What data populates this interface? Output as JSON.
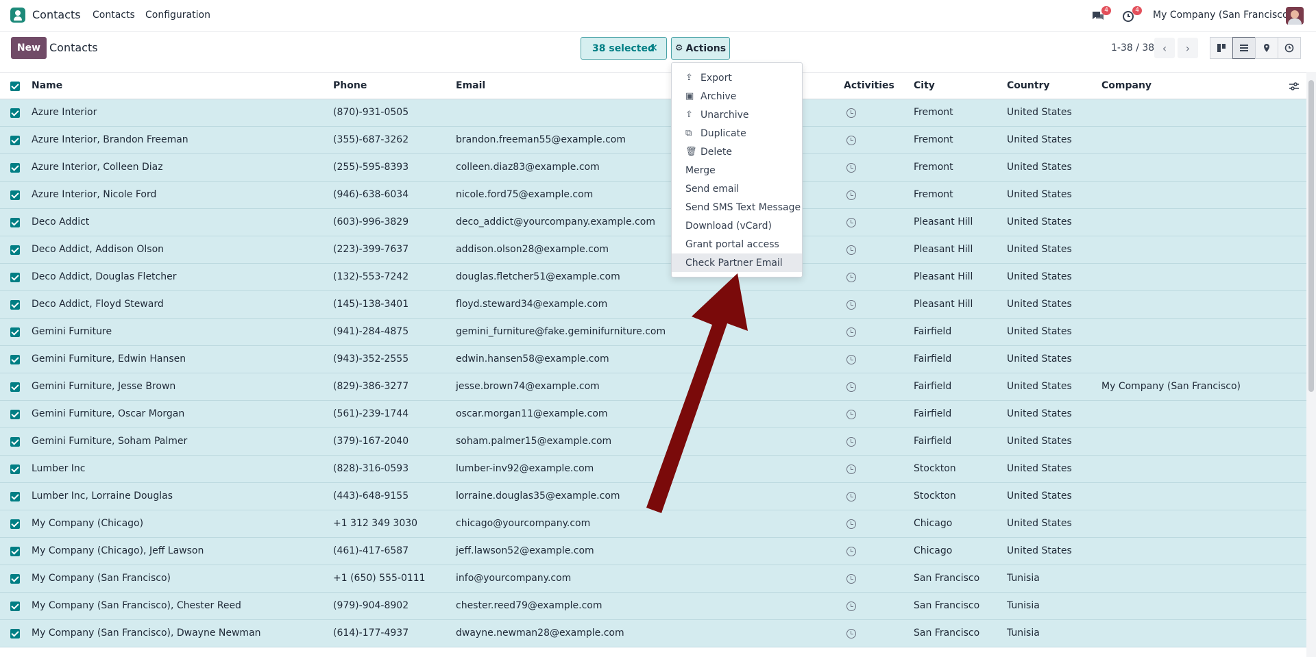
{
  "navbar": {
    "app_name": "Contacts",
    "menu": [
      "Contacts",
      "Configuration"
    ],
    "messages_badge": "4",
    "activities_badge": "4",
    "company": "My Company (San Francisco)"
  },
  "control": {
    "new_label": "New",
    "breadcrumb": "Contacts",
    "selected_label": "38 selected",
    "actions_label": "Actions",
    "pager": "1-38 / 38"
  },
  "columns": {
    "name": "Name",
    "phone": "Phone",
    "email": "Email",
    "activities": "Activities",
    "city": "City",
    "country": "Country",
    "company": "Company"
  },
  "rows": [
    {
      "name": "Azure Interior",
      "phone": "(870)-931-0505",
      "email": "",
      "city": "Fremont",
      "country": "United States",
      "company": ""
    },
    {
      "name": "Azure Interior, Brandon Freeman",
      "phone": "(355)-687-3262",
      "email": "brandon.freeman55@example.com",
      "city": "Fremont",
      "country": "United States",
      "company": ""
    },
    {
      "name": "Azure Interior, Colleen Diaz",
      "phone": "(255)-595-8393",
      "email": "colleen.diaz83@example.com",
      "city": "Fremont",
      "country": "United States",
      "company": ""
    },
    {
      "name": "Azure Interior, Nicole Ford",
      "phone": "(946)-638-6034",
      "email": "nicole.ford75@example.com",
      "city": "Fremont",
      "country": "United States",
      "company": ""
    },
    {
      "name": "Deco Addict",
      "phone": "(603)-996-3829",
      "email": "deco_addict@yourcompany.example.com",
      "city": "Pleasant Hill",
      "country": "United States",
      "company": ""
    },
    {
      "name": "Deco Addict, Addison Olson",
      "phone": "(223)-399-7637",
      "email": "addison.olson28@example.com",
      "city": "Pleasant Hill",
      "country": "United States",
      "company": ""
    },
    {
      "name": "Deco Addict, Douglas Fletcher",
      "phone": "(132)-553-7242",
      "email": "douglas.fletcher51@example.com",
      "city": "Pleasant Hill",
      "country": "United States",
      "company": ""
    },
    {
      "name": "Deco Addict, Floyd Steward",
      "phone": "(145)-138-3401",
      "email": "floyd.steward34@example.com",
      "city": "Pleasant Hill",
      "country": "United States",
      "company": ""
    },
    {
      "name": "Gemini Furniture",
      "phone": "(941)-284-4875",
      "email": "gemini_furniture@fake.geminifurniture.com",
      "city": "Fairfield",
      "country": "United States",
      "company": ""
    },
    {
      "name": "Gemini Furniture, Edwin Hansen",
      "phone": "(943)-352-2555",
      "email": "edwin.hansen58@example.com",
      "city": "Fairfield",
      "country": "United States",
      "company": ""
    },
    {
      "name": "Gemini Furniture, Jesse Brown",
      "phone": "(829)-386-3277",
      "email": "jesse.brown74@example.com",
      "city": "Fairfield",
      "country": "United States",
      "company": "My Company (San Francisco)"
    },
    {
      "name": "Gemini Furniture, Oscar Morgan",
      "phone": "(561)-239-1744",
      "email": "oscar.morgan11@example.com",
      "city": "Fairfield",
      "country": "United States",
      "company": ""
    },
    {
      "name": "Gemini Furniture, Soham Palmer",
      "phone": "(379)-167-2040",
      "email": "soham.palmer15@example.com",
      "city": "Fairfield",
      "country": "United States",
      "company": ""
    },
    {
      "name": "Lumber Inc",
      "phone": "(828)-316-0593",
      "email": "lumber-inv92@example.com",
      "city": "Stockton",
      "country": "United States",
      "company": ""
    },
    {
      "name": "Lumber Inc, Lorraine Douglas",
      "phone": "(443)-648-9155",
      "email": "lorraine.douglas35@example.com",
      "city": "Stockton",
      "country": "United States",
      "company": ""
    },
    {
      "name": "My Company (Chicago)",
      "phone": "+1 312 349 3030",
      "email": "chicago@yourcompany.com",
      "city": "Chicago",
      "country": "United States",
      "company": ""
    },
    {
      "name": "My Company (Chicago), Jeff Lawson",
      "phone": "(461)-417-6587",
      "email": "jeff.lawson52@example.com",
      "city": "Chicago",
      "country": "United States",
      "company": ""
    },
    {
      "name": "My Company (San Francisco)",
      "phone": "+1 (650) 555-0111",
      "email": "info@yourcompany.com",
      "city": "San Francisco",
      "country": "Tunisia",
      "company": ""
    },
    {
      "name": "My Company (San Francisco), Chester Reed",
      "phone": "(979)-904-8902",
      "email": "chester.reed79@example.com",
      "city": "San Francisco",
      "country": "Tunisia",
      "company": ""
    },
    {
      "name": "My Company (San Francisco), Dwayne Newman",
      "phone": "(614)-177-4937",
      "email": "dwayne.newman28@example.com",
      "city": "San Francisco",
      "country": "Tunisia",
      "company": ""
    }
  ],
  "actions_menu": [
    {
      "label": "Export",
      "icon": "upload-icon"
    },
    {
      "label": "Archive",
      "icon": "archive-icon"
    },
    {
      "label": "Unarchive",
      "icon": "unarchive-icon"
    },
    {
      "label": "Duplicate",
      "icon": "copy-icon"
    },
    {
      "label": "Delete",
      "icon": "trash-icon"
    },
    {
      "label": "Merge",
      "icon": ""
    },
    {
      "label": "Send email",
      "icon": ""
    },
    {
      "label": "Send SMS Text Message",
      "icon": ""
    },
    {
      "label": "Download (vCard)",
      "icon": ""
    },
    {
      "label": "Grant portal access",
      "icon": ""
    },
    {
      "label": "Check Partner Email",
      "icon": ""
    }
  ],
  "colors": {
    "brand": "#714b67",
    "accent": "#017e84",
    "row_selected": "#d4ebef",
    "annotation_arrow": "#7a0a0a"
  }
}
